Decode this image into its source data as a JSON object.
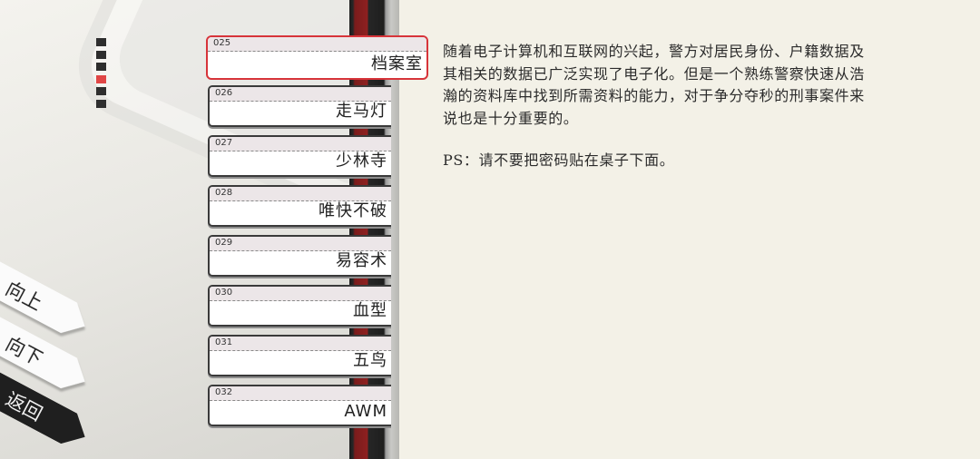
{
  "pager": {
    "total": 6,
    "active_index": 3
  },
  "levels": [
    {
      "num": "025",
      "title": "档案室",
      "selected": true
    },
    {
      "num": "026",
      "title": "走马灯",
      "selected": false
    },
    {
      "num": "027",
      "title": "少林寺",
      "selected": false
    },
    {
      "num": "028",
      "title": "唯快不破",
      "selected": false
    },
    {
      "num": "029",
      "title": "易容术",
      "selected": false
    },
    {
      "num": "030",
      "title": "血型",
      "selected": false
    },
    {
      "num": "031",
      "title": "五鸟",
      "selected": false
    },
    {
      "num": "032",
      "title": "AWM",
      "selected": false
    }
  ],
  "nav": {
    "up_label": "向上",
    "down_label": "向下",
    "back_label": "返回"
  },
  "description": {
    "body": "随着电子计算机和互联网的兴起，警方对居民身份、户籍数据及其相关的数据已广泛实现了电子化。但是一个熟练警察快速从浩瀚的资料库中找到所需资料的能力，对于争分夺秒的刑事案件来说也是十分重要的。",
    "ps": "PS：请不要把密码贴在桌子下面。"
  },
  "colors": {
    "accent_red": "#d7343a",
    "pager_active": "#e04646",
    "strip_red": "#8e2020",
    "panel_bg": "#f3f1e7"
  }
}
